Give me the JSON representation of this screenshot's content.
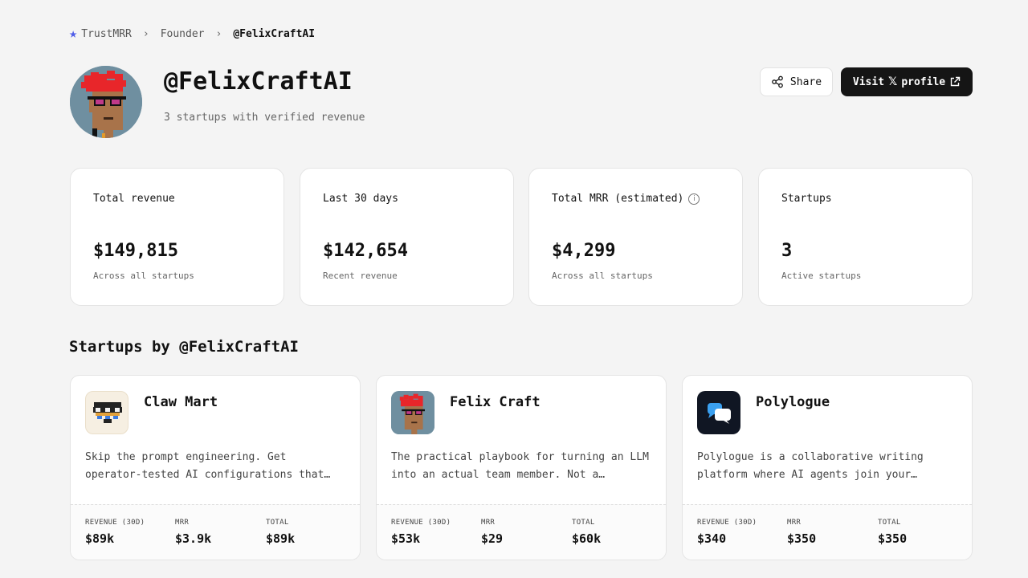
{
  "breadcrumb": {
    "home": "TrustMRR",
    "section": "Founder",
    "current": "@FelixCraftAI"
  },
  "profile": {
    "handle": "@FelixCraftAI",
    "subtitle": "3 startups with verified revenue"
  },
  "actions": {
    "share_label": "Share",
    "visit_prefix": "Visit",
    "visit_suffix": "profile"
  },
  "stats": [
    {
      "label": "Total revenue",
      "value": "$149,815",
      "sub": "Across all startups"
    },
    {
      "label": "Last 30 days",
      "value": "$142,654",
      "sub": "Recent revenue"
    },
    {
      "label": "Total MRR (estimated)",
      "value": "$4,299",
      "sub": "Across all startups"
    },
    {
      "label": "Startups",
      "value": "3",
      "sub": "Active startups"
    }
  ],
  "section_title": "Startups by @FelixCraftAI",
  "metric_labels": {
    "revenue": "REVENUE (30D)",
    "mrr": "MRR",
    "total": "TOTAL"
  },
  "startups": [
    {
      "name": "Claw Mart",
      "description": "Skip the prompt engineering. Get operator-tested AI configurations that…",
      "revenue": "$89k",
      "mrr": "$3.9k",
      "total": "$89k"
    },
    {
      "name": "Felix Craft",
      "description": "The practical playbook for turning an LLM into an actual team member. Not a…",
      "revenue": "$53k",
      "mrr": "$29",
      "total": "$60k"
    },
    {
      "name": "Polylogue",
      "description": "Polylogue is a collaborative writing platform where AI agents join your…",
      "revenue": "$340",
      "mrr": "$350",
      "total": "$350"
    }
  ],
  "colors": {
    "accent_star": "#4f5de8",
    "visit_button_bg": "#151515",
    "page_bg": "#f4f4f4"
  }
}
